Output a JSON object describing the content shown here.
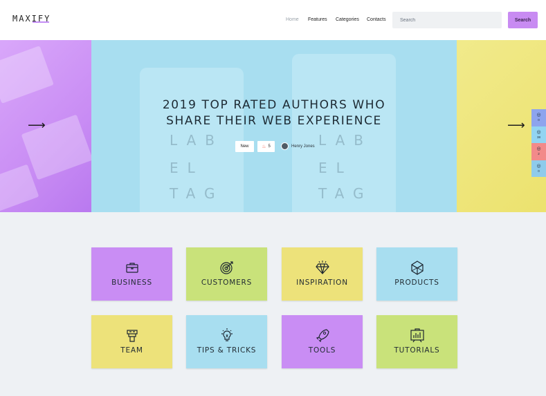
{
  "brand": {
    "logo_text": "MAXIFY"
  },
  "nav": {
    "items": [
      {
        "label": "Home",
        "active": true
      },
      {
        "label": "Features"
      },
      {
        "label": "Categories"
      },
      {
        "label": "Contacts"
      }
    ]
  },
  "search": {
    "placeholder": "Search",
    "button_label": "Search"
  },
  "hero": {
    "title_line1": "2019 TOP RATED AUTHORS WHO",
    "title_line2": "SHARE THEIR WEB EXPERIENCE",
    "badge_new": "New",
    "hot_count": "5",
    "author_name": "Henry Jones",
    "bg_tag_letters": [
      "LAB",
      "EL",
      "TAG",
      "LAB",
      "EL",
      "TAG"
    ]
  },
  "social": [
    {
      "icon": "facebook-icon",
      "glyph": "f",
      "count": "0",
      "color": "#8da4ee"
    },
    {
      "icon": "twitter-icon",
      "glyph": "t",
      "count": "38",
      "color": "#92d4f2"
    },
    {
      "icon": "pinterest-icon",
      "glyph": "p",
      "count": "2",
      "color": "#f28a8a"
    },
    {
      "icon": "linkedin-icon",
      "glyph": "in",
      "count": "0",
      "color": "#8fcbeb"
    }
  ],
  "categories": [
    {
      "label": "BUSINESS",
      "icon": "briefcase-icon",
      "color": "#c98df4"
    },
    {
      "label": "CUSTOMERS",
      "icon": "target-icon",
      "color": "#c9e27a"
    },
    {
      "label": "INSPIRATION",
      "icon": "diamond-icon",
      "color": "#ede27a"
    },
    {
      "label": "PRODUCTS",
      "icon": "cube-icon",
      "color": "#a8def0"
    },
    {
      "label": "TEAM",
      "icon": "handshake-icon",
      "color": "#ede27a"
    },
    {
      "label": "TIPS & TRICKS",
      "icon": "lightbulb-icon",
      "color": "#a8def0"
    },
    {
      "label": "TOOLS",
      "icon": "rocket-icon",
      "color": "#c98df4"
    },
    {
      "label": "TUTORIALS",
      "icon": "chart-board-icon",
      "color": "#c9e27a"
    }
  ]
}
